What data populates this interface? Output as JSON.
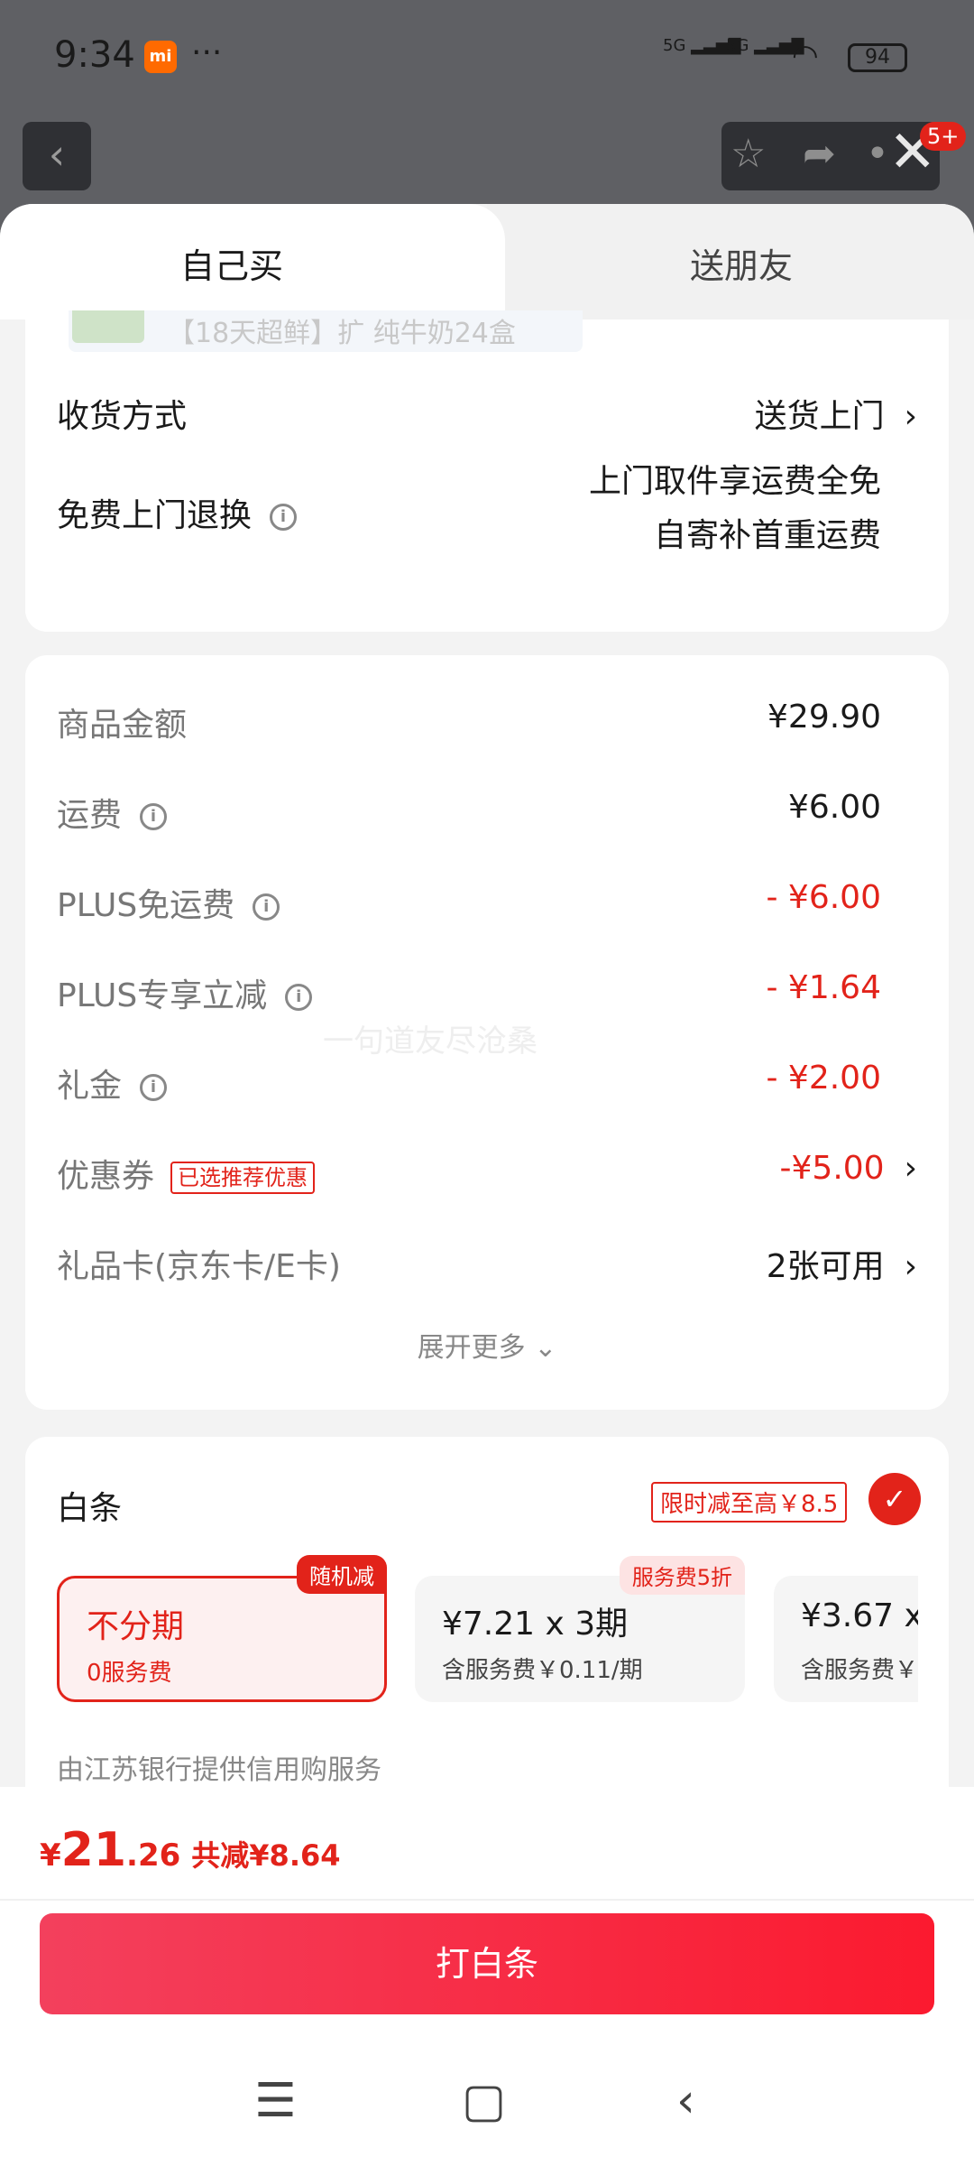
{
  "status_bar": {
    "time": "9:34",
    "app_badge": "mi",
    "more": "···",
    "signal1": "5G",
    "signal2": "5G",
    "battery": "94"
  },
  "header": {
    "back_icon": "chevron-left-icon",
    "notif_badge": "5+"
  },
  "tabs": [
    {
      "label": "自己买",
      "active": true
    },
    {
      "label": "送朋友",
      "active": false
    }
  ],
  "product_peek": {
    "text": "【18天超鲜】扩 纯牛奶24盒"
  },
  "delivery": {
    "method_label": "收货方式",
    "method_value": "送货上门",
    "return_label": "免费上门退换",
    "return_line1": "上门取件享运费全免",
    "return_line2": "自寄补首重运费"
  },
  "price_details": [
    {
      "label": "商品金额",
      "value": "¥29.90",
      "info": false
    },
    {
      "label": "运费",
      "value": "¥6.00",
      "info": true
    },
    {
      "label": "PLUS免运费",
      "value": "- ¥6.00",
      "info": true
    },
    {
      "label": "PLUS专享立减",
      "value": "- ¥1.64",
      "info": true
    },
    {
      "label": "礼金",
      "value": "- ¥2.00",
      "info": true
    },
    {
      "label": "优惠券",
      "tag": "已选推荐优惠",
      "value": "-¥5.00"
    },
    {
      "label": "礼品卡(京东卡/E卡)",
      "value": "2张可用"
    }
  ],
  "expand_more": "展开更多",
  "watermark": "一句道友尽沧桑",
  "baitiao": {
    "title": "白条",
    "promo": "限时减至高￥8.5",
    "options": [
      {
        "main": "不分期",
        "sub": "0服务费",
        "corner": "随机减"
      },
      {
        "main": "¥7.21 x 3期",
        "sub": "含服务费￥0.11/期",
        "corner": "服务费5折"
      },
      {
        "main": "¥3.67 x",
        "sub": "含服务费￥"
      }
    ],
    "provider": "由江苏银行提供信用购服务"
  },
  "footer": {
    "currency": "¥",
    "total_int": "21",
    "total_dec": ".26",
    "saved": "共减¥8.64",
    "pay_button": "打白条"
  },
  "colors": {
    "accent": "#e2231a",
    "button_gradient_start": "#f3405d",
    "button_gradient_end": "#fb1a2f"
  }
}
